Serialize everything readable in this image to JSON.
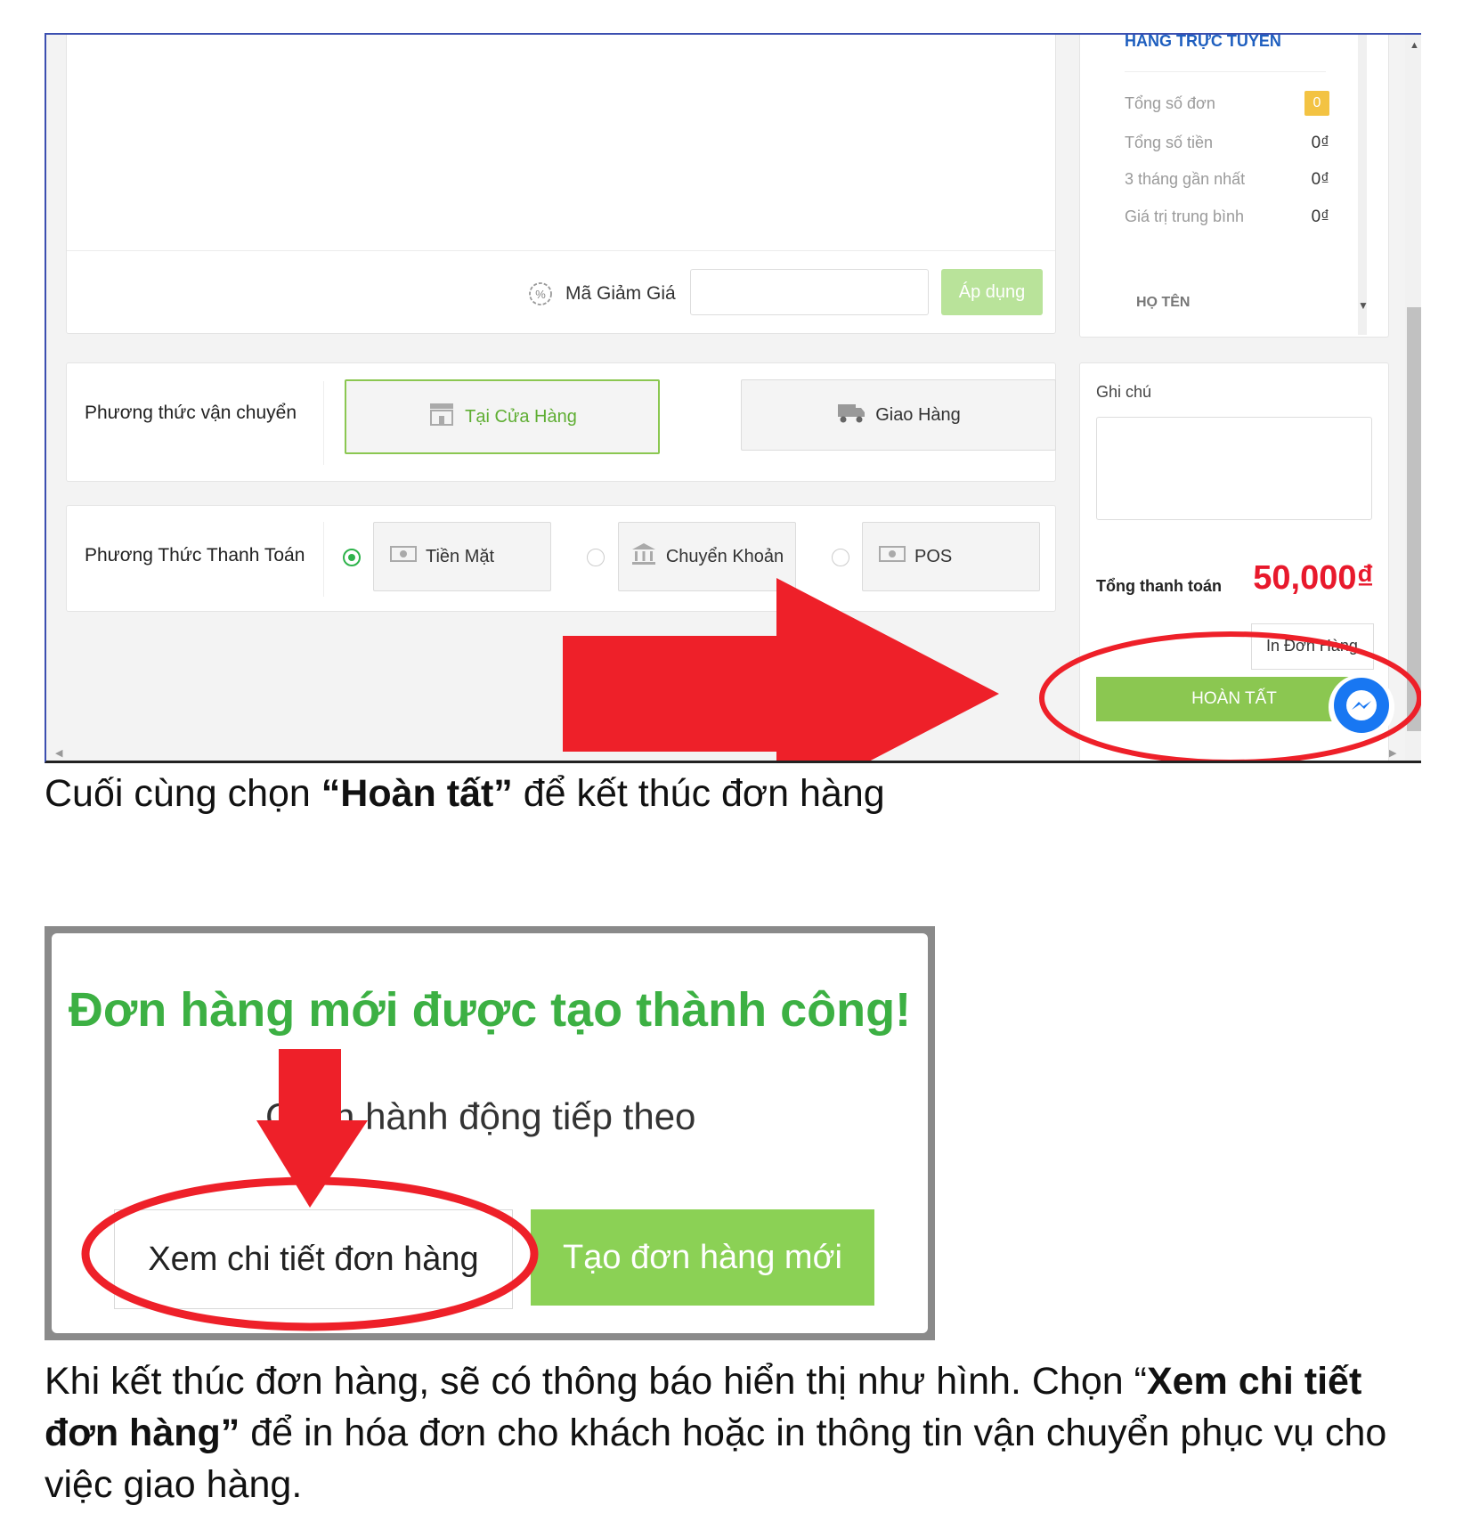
{
  "shot1": {
    "sidebar_top": {
      "heading": "HÀNG TRỰC TUYẾN",
      "stats": [
        {
          "label": "Tổng số đơn",
          "value": "0"
        },
        {
          "label": "Tổng số tiền",
          "value": "0₫"
        },
        {
          "label": "3 tháng gần nhất",
          "value": "0₫"
        },
        {
          "label": "Giá trị trung bình",
          "value": "0₫"
        }
      ],
      "ho_ten": "HỌ TÊN"
    },
    "discount": {
      "label": "Mã Giảm Giá",
      "apply": "Áp dụng"
    },
    "shipping": {
      "label": "Phương thức vận chuyển",
      "store": "Tại Cửa Hàng",
      "delivery": "Giao Hàng"
    },
    "payment": {
      "label": "Phương Thức Thanh Toán",
      "cash": "Tiền Mặt",
      "transfer": "Chuyển Khoản",
      "pos": "POS"
    },
    "note": {
      "label": "Ghi chú"
    },
    "total": {
      "label": "Tổng thanh toán",
      "value": "50,000₫"
    },
    "print_button": "In Đơn Hàng",
    "complete_button": "HOÀN TẤT",
    "colors": {
      "green": "#8bc751",
      "red_total": "#e8192c",
      "annotation_red": "#ee2029",
      "blue_heading": "#1f5fbf"
    }
  },
  "caption1": {
    "before": "Cuối cùng chọn ",
    "bold": "“Hoàn tất”",
    "after": " để kết thúc đơn hàng"
  },
  "shot2": {
    "success_title": "Đơn hàng mới được tạo thành công!",
    "prompt": "Chọn hành động tiếp theo",
    "view_button": "Xem chi tiết đơn hàng",
    "new_button": "Tạo đơn hàng mới",
    "colors": {
      "title_green": "#3cb043",
      "button_green": "#8bd155"
    }
  },
  "caption2": {
    "part1": "Khi kết thúc đơn hàng, sẽ có thông báo hiển thị như hình. Chọn “",
    "bold1": "Xem chi tiết đơn hàng”",
    "part2": " để in hóa đơn cho khách hoặc in thông tin vận chuyển phục vụ cho việc giao hàng."
  }
}
